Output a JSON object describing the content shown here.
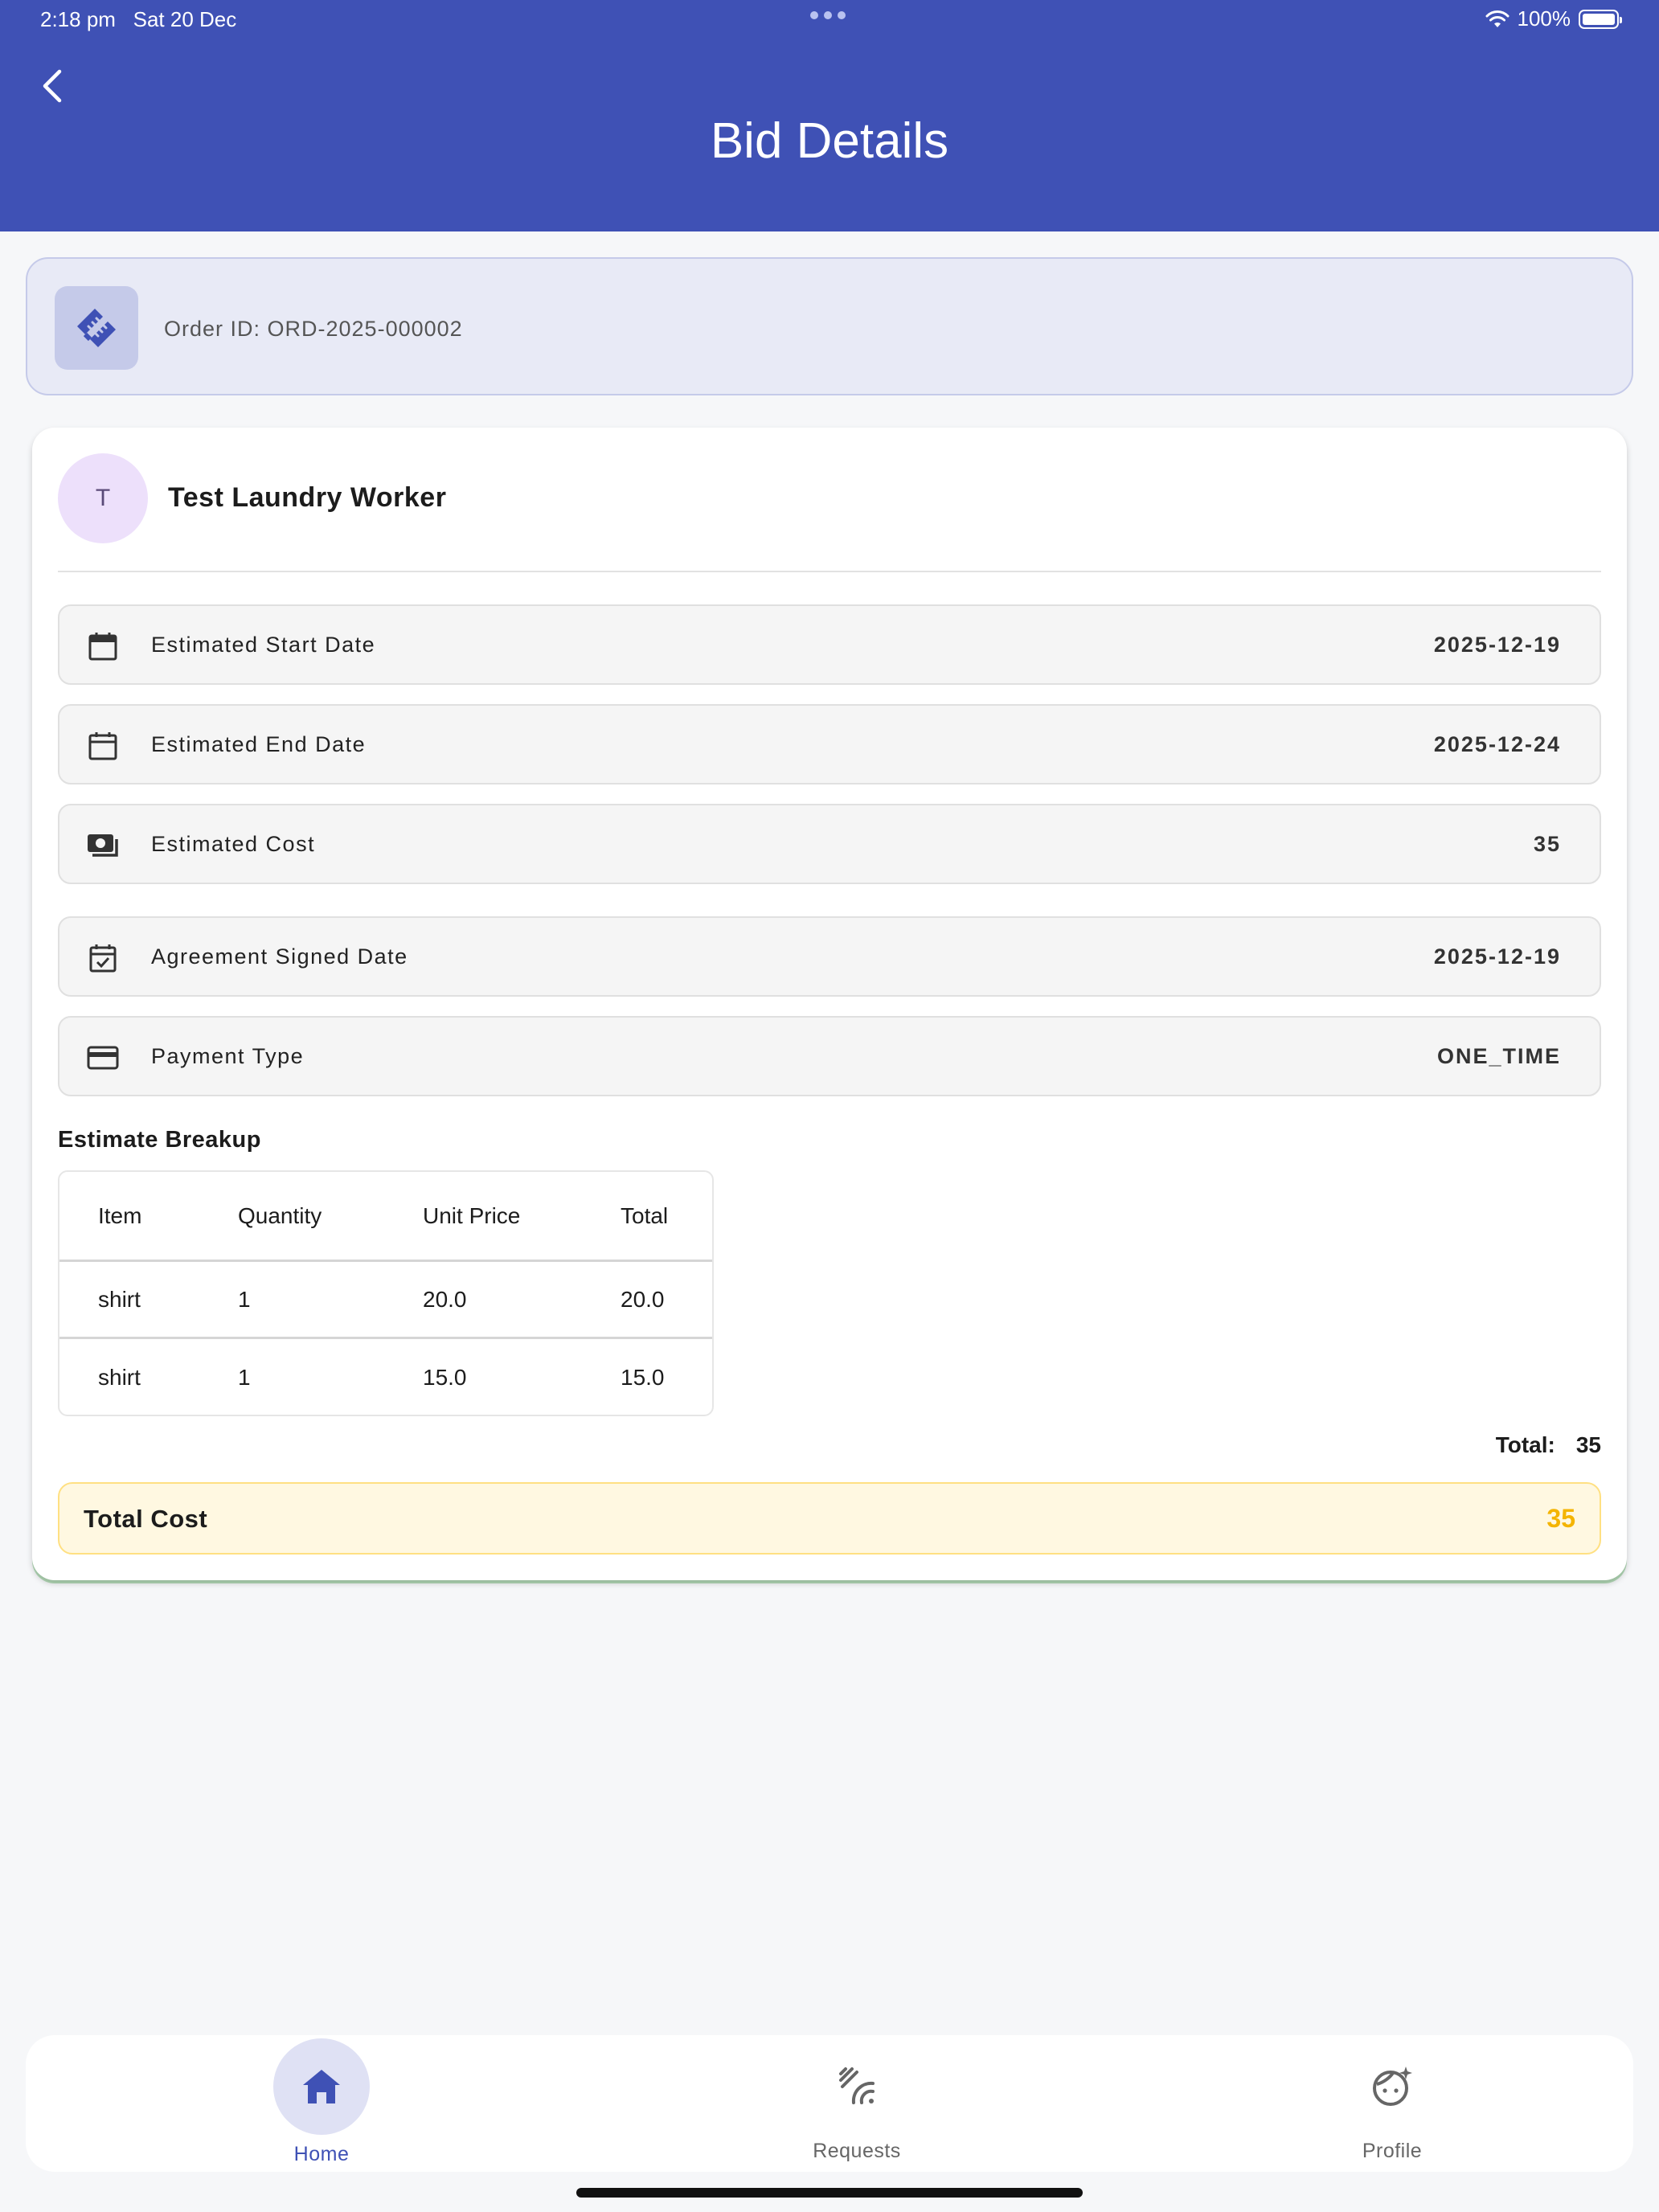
{
  "status_bar": {
    "time": "2:18 pm",
    "date": "Sat 20 Dec",
    "battery": "100%"
  },
  "header": {
    "title": "Bid Details"
  },
  "order": {
    "id_text": "Order ID: ORD-2025-000002"
  },
  "worker": {
    "initial": "T",
    "name": "Test Laundry Worker"
  },
  "details": [
    {
      "icon": "calendar-icon",
      "label": "Estimated Start Date",
      "value": "2025-12-19"
    },
    {
      "icon": "calendar-icon",
      "label": "Estimated End Date",
      "value": "2025-12-24"
    },
    {
      "icon": "money-icon",
      "label": "Estimated Cost",
      "value": "35"
    },
    {
      "icon": "calendar-check-icon",
      "label": "Agreement Signed Date",
      "value": "2025-12-19"
    },
    {
      "icon": "credit-card-icon",
      "label": "Payment Type",
      "value": "ONE_TIME"
    }
  ],
  "breakup": {
    "title": "Estimate Breakup",
    "columns": [
      "Item",
      "Quantity",
      "Unit Price",
      "Total"
    ],
    "rows": [
      [
        "shirt",
        "1",
        "20.0",
        "20.0"
      ],
      [
        "shirt",
        "1",
        "15.0",
        "15.0"
      ]
    ],
    "total_label": "Total:",
    "total_value": "35"
  },
  "total_cost": {
    "label": "Total Cost",
    "value": "35"
  },
  "nav": {
    "items": [
      {
        "label": "Home",
        "icon": "home-icon",
        "active": true
      },
      {
        "label": "Requests",
        "icon": "requests-icon",
        "active": false
      },
      {
        "label": "Profile",
        "icon": "profile-icon",
        "active": false
      }
    ]
  },
  "colors": {
    "primary": "#3f51b5",
    "accent_total": "#f4b400",
    "avatar_bg": "#ede0fb"
  }
}
